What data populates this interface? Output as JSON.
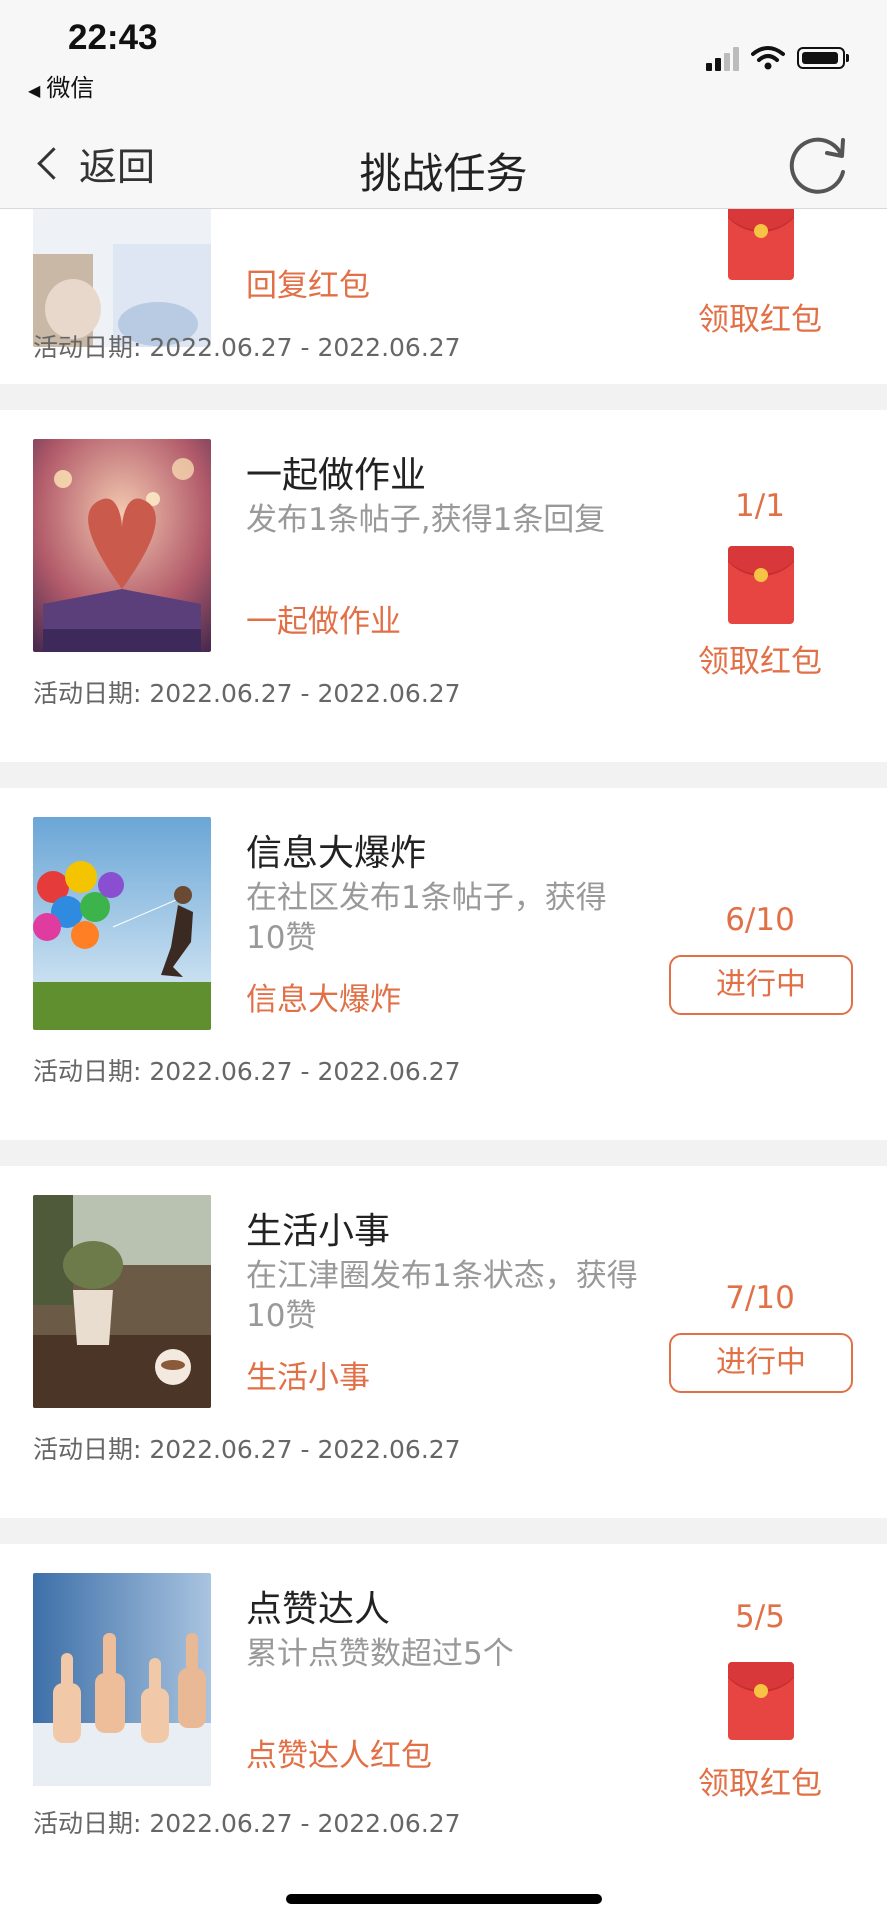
{
  "status_bar": {
    "time": "22:43",
    "back_app": "微信"
  },
  "nav": {
    "back_label": "返回",
    "title": "挑战任务"
  },
  "tasks": [
    {
      "title": "",
      "desc": "",
      "link": "回复红包",
      "date_label": "活动日期:",
      "date": "2022.06.27 - 2022.06.27",
      "progress": "",
      "action": "领取红包",
      "action_type": "claim"
    },
    {
      "title": "一起做作业",
      "desc": "发布1条帖子,获得1条回复",
      "link": "一起做作业",
      "date_label": "活动日期:",
      "date": "2022.06.27 - 2022.06.27",
      "progress": "1/1",
      "action": "领取红包",
      "action_type": "claim"
    },
    {
      "title": "信息大爆炸",
      "desc": "在社区发布1条帖子，获得10赞",
      "link": "信息大爆炸",
      "date_label": "活动日期:",
      "date": "2022.06.27 - 2022.06.27",
      "progress": "6/10",
      "action": "进行中",
      "action_type": "in_progress"
    },
    {
      "title": "生活小事",
      "desc": "在江津圈发布1条状态，获得10赞",
      "link": "生活小事",
      "date_label": "活动日期:",
      "date": "2022.06.27 - 2022.06.27",
      "progress": "7/10",
      "action": "进行中",
      "action_type": "in_progress"
    },
    {
      "title": "点赞达人",
      "desc": "累计点赞数超过5个",
      "link": "点赞达人红包",
      "date_label": "活动日期:",
      "date": "2022.06.27 - 2022.06.27",
      "progress": "5/5",
      "action": "领取红包",
      "action_type": "claim"
    }
  ],
  "colors": {
    "accent": "#e27047",
    "envelope": "#e64541",
    "background": "#f2f2f2"
  }
}
